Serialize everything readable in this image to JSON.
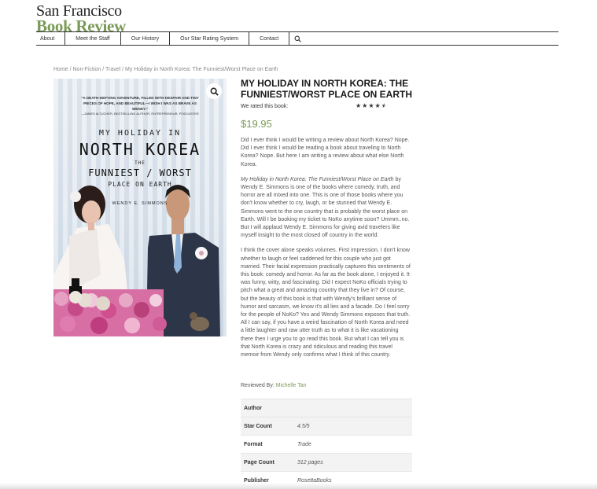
{
  "logo": {
    "line1": "San Francisco",
    "line2": "Book Review"
  },
  "nav": {
    "items": [
      "About",
      "Meet the Staff",
      "Our History",
      "Our Star Rating System",
      "Contact"
    ]
  },
  "breadcrumb": "Home / Non-Fiction / Travel / My Holiday in North Korea: The Funniest/Worst Place on Earth",
  "cover": {
    "blurb": "\"A DEATH-DEFYING ADVENTURE, FILLED WITH DESPAIR AND TINY PIECES OF HOPE, AND BEAUTIFUL—I WISH I WAS AS BRAVE AS WENDY.\"",
    "blurb_credit": "—JAMES ALTUCHER, BESTSELLING AUTHOR, ENTREPRENEUR, PODCASTER",
    "line1": "MY HOLIDAY IN",
    "line2": "NORTH KOREA",
    "line3": "THE",
    "line4": "FUNNIEST / WORST",
    "line5": "PLACE ON EARTH",
    "author": "WENDY E. SIMMONS"
  },
  "product": {
    "title": "My Holiday in North Korea: The Funniest/Worst Place on Earth",
    "rated_label": "We rated this book:",
    "rating": 4.5,
    "rating_max": 5,
    "price": "$19.95"
  },
  "review": {
    "p1": "Did I ever think I would be writing a review about North Korea? Nope. Did I ever think I would be reading a book about traveling to North Korea? Nope. But here I am writing a review about what else North Korea.",
    "p2_title": "My Holiday in North Korea: The Funniest/Worst Place on Earth",
    "p2_rest": " by Wendy E. Simmons is one of the books where comedy, truth, and horror are all mixed into one. This is one of those books where you don't know whether to cry, laugh, or be stunned that Wendy E. Simmons went to the one country that is probably the worst place on Earth. Will I be booking my ticket to NoKo anytime soon? Ummm..no. But I will applaud Wendy E. Simmons for giving avid travelers like myself insight to the most closed off country in the world.",
    "p3": "I think the cover alone speaks volumes. First impression, I don't know whether to laugh or feel saddened for this couple who just got married. Their facial expression practically captures this sentiments of this book: comedy and horror. As far as the book alone, I enjoyed it. It was funny, witty, and fascinating. Did I expect NoKo officials trying to pitch what a great and amazing country that they live in? Of course, but the beauty of this book is that with Wendy's brilliant sense of humor and sarcasm, we know it's all lies and a facade. Do I feel sorry for the people of NoKo? Yes and Wendy Simmons exposes that truth. All I can say, if you have a weird fascination of North Korea and need a little laughter and raw utter truth as to what it is like vacationing there then I urge you to go read this book. But what I can tell you is that North Korea is crazy and ridiculous and reading this travel memoir from Wendy only confirms what I think of this country.",
    "reviewed_by_label": "Reviewed By:",
    "reviewer_name": "Michelle Tan"
  },
  "details": [
    {
      "label": "Author",
      "value": ""
    },
    {
      "label": "Star Count",
      "value": "4.5/5"
    },
    {
      "label": "Format",
      "value": "Trade"
    },
    {
      "label": "Page Count",
      "value": "312 pages"
    },
    {
      "label": "Publisher",
      "value": "RosettaBooks"
    }
  ],
  "colors": {
    "accent": "#7b9a57",
    "text": "#555555",
    "heading": "#1a1a1a"
  }
}
